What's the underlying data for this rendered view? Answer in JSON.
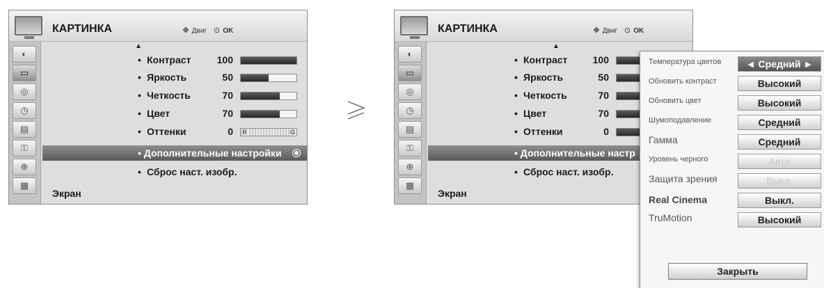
{
  "left": {
    "header": {
      "title": "КАРТИНКА",
      "nav_label": "Двиг",
      "ok_label": "OK"
    },
    "items": [
      {
        "label": "Контраст",
        "value": "100",
        "level": 1.0
      },
      {
        "label": "Яркость",
        "value": "50",
        "level": 0.5
      },
      {
        "label": "Четкость",
        "value": "70",
        "level": 0.7
      },
      {
        "label": "Цвет",
        "value": "70",
        "level": 0.7
      },
      {
        "label": "Оттенки",
        "value": "0"
      }
    ],
    "tint": {
      "r": "R",
      "g": "G"
    },
    "selected_item": "Дополнительные настройки",
    "reset_item": "Сброс наст. изобр.",
    "footer": "Экран"
  },
  "separator": "≥",
  "right": {
    "header": {
      "title": "КАРТИНКА",
      "nav_label": "Двиг",
      "ok_label": "OK"
    },
    "items": [
      {
        "label": "Контраст",
        "value": "100"
      },
      {
        "label": "Яркость",
        "value": "50"
      },
      {
        "label": "Четкость",
        "value": "70"
      },
      {
        "label": "Цвет",
        "value": "70"
      },
      {
        "label": "Оттенки",
        "value": "0"
      }
    ],
    "selected_item": "Дополнительные настр",
    "reset_item": "Сброс наст. изобр.",
    "footer": "Экран"
  },
  "popup": {
    "rows": [
      {
        "label": "Температура цветов",
        "value": "◄ Средний ►"
      },
      {
        "label": "Обновить контраст",
        "value": "Высокий"
      },
      {
        "label": "Обновить цвет",
        "value": "Высокий"
      },
      {
        "label": "Шумоподавление",
        "value": "Средний"
      },
      {
        "label": "Гамма",
        "value": "Средний"
      },
      {
        "label": "Уровень черного",
        "value": "Авто"
      },
      {
        "label": "Защита зрения",
        "value": "Выкл."
      },
      {
        "label": "Real Cinema",
        "value": "Выкл."
      },
      {
        "label": "TruMotion",
        "value": "Высокий"
      }
    ],
    "close_label": "Закрыть"
  }
}
